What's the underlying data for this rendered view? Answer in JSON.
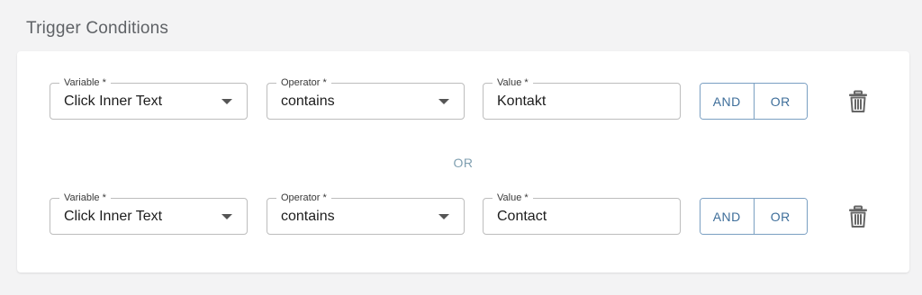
{
  "section": {
    "title": "Trigger Conditions"
  },
  "separator": {
    "label": "OR"
  },
  "conditions": [
    {
      "variable": {
        "label": "Variable *",
        "value": "Click Inner Text"
      },
      "operator": {
        "label": "Operator *",
        "value": "contains"
      },
      "value": {
        "label": "Value *",
        "value": "Kontakt"
      },
      "and_label": "AND",
      "or_label": "OR",
      "delete_icon": "trash-icon"
    },
    {
      "variable": {
        "label": "Variable *",
        "value": "Click Inner Text"
      },
      "operator": {
        "label": "Operator *",
        "value": "contains"
      },
      "value": {
        "label": "Value *",
        "value": "Contact"
      },
      "and_label": "AND",
      "or_label": "OR",
      "delete_icon": "trash-icon"
    }
  ],
  "colors": {
    "accent": "#3e6e9a",
    "separator": "#7f9fb0",
    "background": "#f3f3f4"
  }
}
